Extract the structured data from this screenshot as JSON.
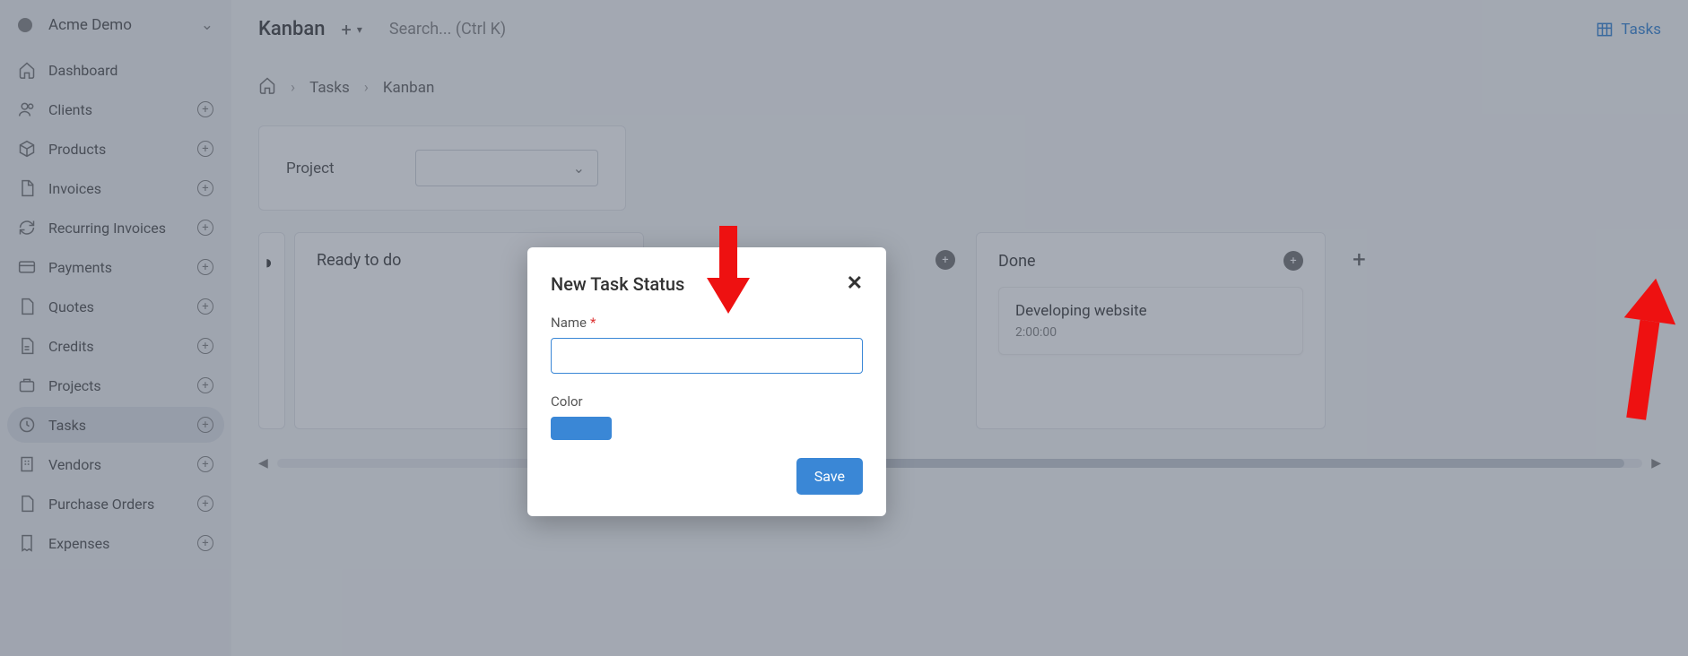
{
  "org": {
    "name": "Acme Demo"
  },
  "nav": [
    {
      "label": "Dashboard",
      "icon": "home",
      "add": false
    },
    {
      "label": "Clients",
      "icon": "users",
      "add": true
    },
    {
      "label": "Products",
      "icon": "cube",
      "add": true
    },
    {
      "label": "Invoices",
      "icon": "file",
      "add": true
    },
    {
      "label": "Recurring Invoices",
      "icon": "refresh",
      "add": true
    },
    {
      "label": "Payments",
      "icon": "card",
      "add": true
    },
    {
      "label": "Quotes",
      "icon": "file2",
      "add": true
    },
    {
      "label": "Credits",
      "icon": "file3",
      "add": true
    },
    {
      "label": "Projects",
      "icon": "briefcase",
      "add": true
    },
    {
      "label": "Tasks",
      "icon": "clock",
      "add": true,
      "active": true
    },
    {
      "label": "Vendors",
      "icon": "building",
      "add": true
    },
    {
      "label": "Purchase Orders",
      "icon": "file4",
      "add": true
    },
    {
      "label": "Expenses",
      "icon": "receipt",
      "add": true
    }
  ],
  "topbar": {
    "title": "Kanban",
    "search_placeholder": "Search... (Ctrl K)",
    "tasks_link": "Tasks"
  },
  "breadcrumb": {
    "level1": "Tasks",
    "level2": "Kanban"
  },
  "filter": {
    "label": "Project"
  },
  "columns": {
    "ready": {
      "title": "Ready to do"
    },
    "done": {
      "title": "Done"
    }
  },
  "card": {
    "title": "Developing website",
    "time": "2:00:00"
  },
  "modal": {
    "title": "New Task Status",
    "name_label": "Name",
    "color_label": "Color",
    "color_value": "#3a87d6",
    "save_label": "Save"
  }
}
